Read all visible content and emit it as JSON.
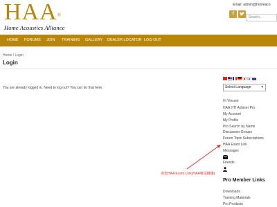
{
  "header": {
    "logo_mark": "HAA",
    "logo_sub": "Home Acoustics Alliance",
    "email": "Email: admin@homeaco",
    "search_placeholder": "Search..."
  },
  "social": [
    {
      "icon": "facebook-icon",
      "glyph": "f"
    },
    {
      "icon": "twitter-icon",
      "glyph": "t"
    }
  ],
  "nav": {
    "home": "HOME",
    "forums": "FORUMS",
    "join": "JOIN",
    "training": "TRAINING",
    "gallery": "GALLERY",
    "dealer_locator": "DEALER LOCATOR",
    "log_out": "LOG OUT"
  },
  "breadcrumb": "Home / Login",
  "page_title": "Login",
  "notice": "You are already logged in. Need to log out? You can do that here.",
  "language": {
    "selected": "Select Language"
  },
  "sidebar": {
    "greeting": "Hi Vincent",
    "links": [
      "HAA HTI Adviser Pro",
      "My Account",
      "My Profile",
      "Pro Search by Name",
      "Discussion Groups",
      "Forum Topic Subscriptions",
      "HAA Exam Link",
      "Messages"
    ],
    "friends": "Friends"
  },
  "pro_links": {
    "title": "Pro Member Links",
    "items": [
      "Downloads",
      "Training Materials",
      "Pro Products"
    ]
  },
  "annotation": "点击HAA Exam Link(HAA考试链接)",
  "colors": {
    "brand_gold": "#b8860b",
    "annotation_red": "#e03030"
  }
}
